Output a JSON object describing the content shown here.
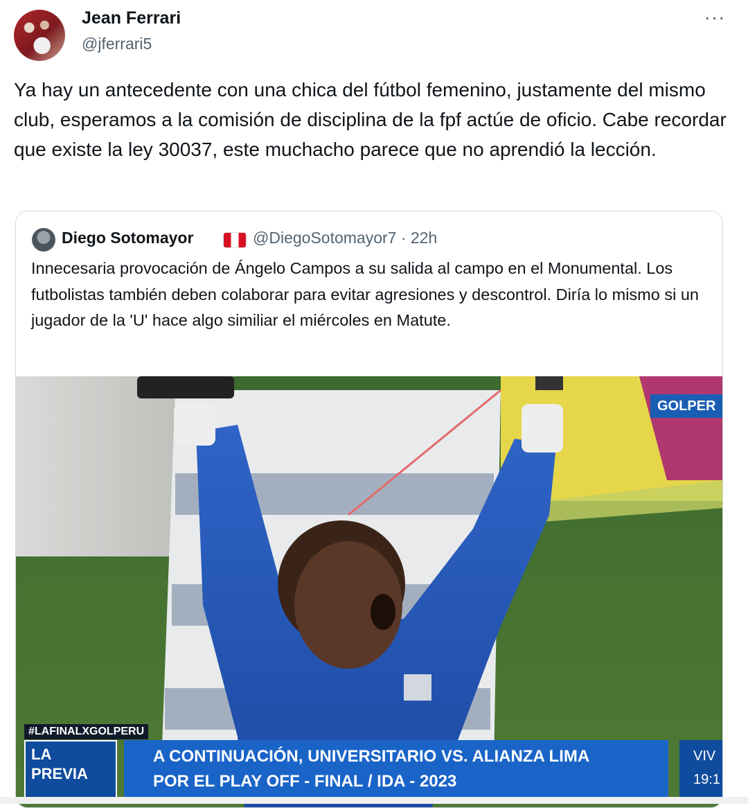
{
  "tweet": {
    "author_name": "Jean Ferrari",
    "author_handle": "@jferrari5",
    "more_icon": "more-horizontal-icon",
    "more_glyph": "···",
    "text": "Ya hay un antecedente con una chica del fútbol femenino, justamente del mismo club, esperamos a la comisión de disciplina de la fpf actúe de oficio. Cabe recordar que existe la ley 30037, este muchacho parece que no aprendió la lección."
  },
  "quoted_tweet": {
    "author_name": "Diego Sotomayor",
    "flag_icon": "peru-flag-icon",
    "author_handle": "@DiegoSotomayor7 · 22h",
    "text": "Innecesaria provocación de Ángelo Campos a su salida al campo en el Monumental. Los futbolistas también deben colaborar para evitar agresiones y descontrol. Diría lo mismo si un jugador de la 'U' hace algo similiar el miércoles en Matute.",
    "media": {
      "channel_logo": "GOLPER",
      "hashtag": "#LAFINALXGOLPERU",
      "program_top": "LA",
      "program_bottom": "PREVIA",
      "headline_line1": "A CONTINUACIÓN, UNIVERSITARIO VS. ALIANZA LIMA",
      "headline_line2": "POR EL PLAY OFF - FINAL / IDA - 2023",
      "live_label": "VIV",
      "live_time": "19:1"
    }
  },
  "colors": {
    "text_primary": "#0f1419",
    "text_secondary": "#536471",
    "border": "#cfd9de",
    "broadcast_blue": "#1a64c8"
  }
}
